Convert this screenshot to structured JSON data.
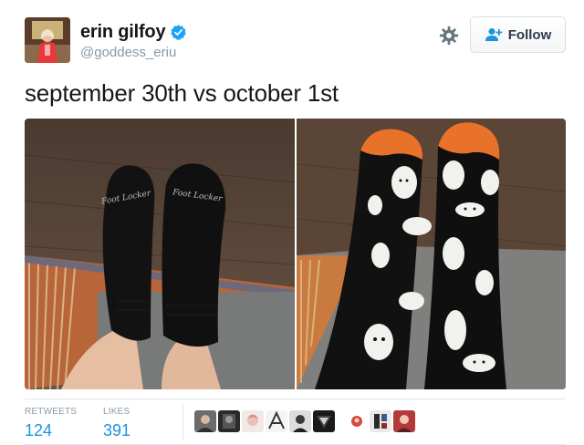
{
  "user": {
    "name": "erin gilfoy",
    "handle": "@goddess_eriu",
    "verified": true
  },
  "actions": {
    "follow_label": "Follow"
  },
  "tweet": {
    "text": "september 30th vs october 1st"
  },
  "photos": [
    {
      "sock_brand_left": "Foot Locker",
      "sock_brand_right": "Foot Locker"
    },
    {
      "sock_pattern": "ghost-icon"
    }
  ],
  "stats": {
    "retweets_label": "RETWEETS",
    "retweets_value": "124",
    "likes_label": "LIKES",
    "likes_value": "391"
  },
  "likers_count_shown": 10,
  "colors": {
    "accent": "#1b95e0",
    "muted": "#8899a6",
    "sock_orange": "#e8722a"
  }
}
